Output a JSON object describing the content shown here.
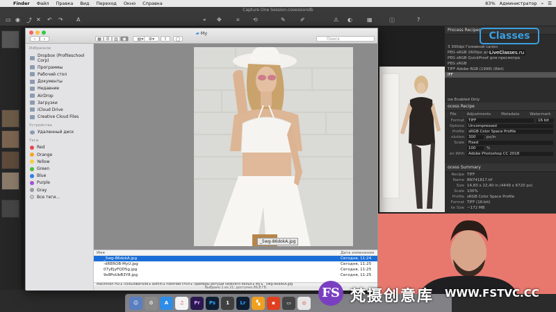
{
  "menubar": {
    "app": "Finder",
    "items": [
      "Файл",
      "Правка",
      "Вид",
      "Переход",
      "Окно",
      "Справка"
    ],
    "battery": "83%",
    "user": "Администратор"
  },
  "c1": {
    "window_title": "Capture One Session.cosessiondb"
  },
  "recipes": {
    "header": "Process Recipes",
    "list": [
      "3 300dpi Головной салон",
      "PEG sRGB 1600px для интернета",
      "PEG sRGB QuickProof для просмотра",
      "PEG sRGB",
      "TIFF Adobe RGB (1998) (8bit)",
      "IFF"
    ],
    "show_enabled": "ow Enabled Only"
  },
  "recipe": {
    "header": "ocess Recipe",
    "tabs": [
      "File",
      "Adjustments",
      "Metadata",
      "Watermark"
    ],
    "format_label": "Format",
    "format_value": "TIFF",
    "bit_value": "16 bit",
    "options_label": "Options",
    "options_value": "Uncompressed",
    "profile_label": "Profile",
    "profile_value": "sRGB Color Space Profile",
    "resolution_label": "olution",
    "resolution_value": "300",
    "resolution_unit": "px/in",
    "scale_label": "Scale",
    "scale_value": "Fixed",
    "percent_value": "100",
    "percent_unit": "%",
    "open_label": "en With",
    "open_value": "Adobe Photoshop CC 2018"
  },
  "summary": {
    "header": "ocess Summary",
    "rows": [
      [
        "Recipe",
        "TIFF"
      ],
      [
        "Name",
        "BN741817.tif"
      ],
      [
        "Size",
        "14,83 x 22,40 in (4449 x 6720 px)"
      ],
      [
        "Scale",
        "100%"
      ],
      [
        "Profile",
        "sRGB Color Space Profile"
      ],
      [
        "Format",
        "TIFF (16-bit)"
      ],
      [
        "ile Size",
        "~172 MB"
      ]
    ]
  },
  "finder": {
    "title": "My",
    "search_placeholder": "Поиск",
    "sidebar": {
      "favorites_label": "Избранное",
      "favorites": [
        "Dropbox (Profileschool Corp)",
        "Программы",
        "Рабочий стол",
        "Документы",
        "Недавние",
        "AirDrop",
        "Загрузки",
        "iCloud Drive",
        "Creative Cloud Files"
      ],
      "devices_label": "Устройства",
      "devices": [
        "Удаленный диск"
      ],
      "tags_label": "Теги",
      "tags": [
        {
          "name": "Red",
          "color": "#e5484d"
        },
        {
          "name": "Orange",
          "color": "#f5a623"
        },
        {
          "name": "Yellow",
          "color": "#f2d03b"
        },
        {
          "name": "Green",
          "color": "#4cbb3a"
        },
        {
          "name": "Blue",
          "color": "#2e7de9"
        },
        {
          "name": "Purple",
          "color": "#a253d2"
        },
        {
          "name": "Gray",
          "color": "#9a9a9a"
        }
      ],
      "all_tags": "Все теги..."
    },
    "preview_caption": "_5wg-86dokA.jpg",
    "list": {
      "col_name": "Имя",
      "col_date": "Дата изменения",
      "rows": [
        {
          "name": "_5wg-86dokA.jpg",
          "date": "Сегодня, 11:24"
        },
        {
          "name": "-dREROB-MyU.jpg",
          "date": "Сегодня, 11:25"
        },
        {
          "name": "07yEjyFQD5g.jpg",
          "date": "Сегодня, 11:25"
        },
        {
          "name": "9s8PoUbB3Y8.jpg",
          "date": "Сегодня, 11:25"
        }
      ]
    },
    "path": "Macintosh HD ▸ Пользователи ▸ admin ▸ Рабочий стол ▸ Примеры ретуши нижнего белья ▸ My ▸ _5wg-86dokA.jpg",
    "status": "Выбрано 1 из 21; доступно 89,8 ГБ"
  },
  "dock": [
    "Ps",
    "Lr"
  ],
  "logo": {
    "brand": "Classes",
    "url": "LiveClasses.ru"
  },
  "watermark": {
    "logo": "FS",
    "cn": "梵摄创意库",
    "url": "WWW.FSTVC.CC"
  }
}
